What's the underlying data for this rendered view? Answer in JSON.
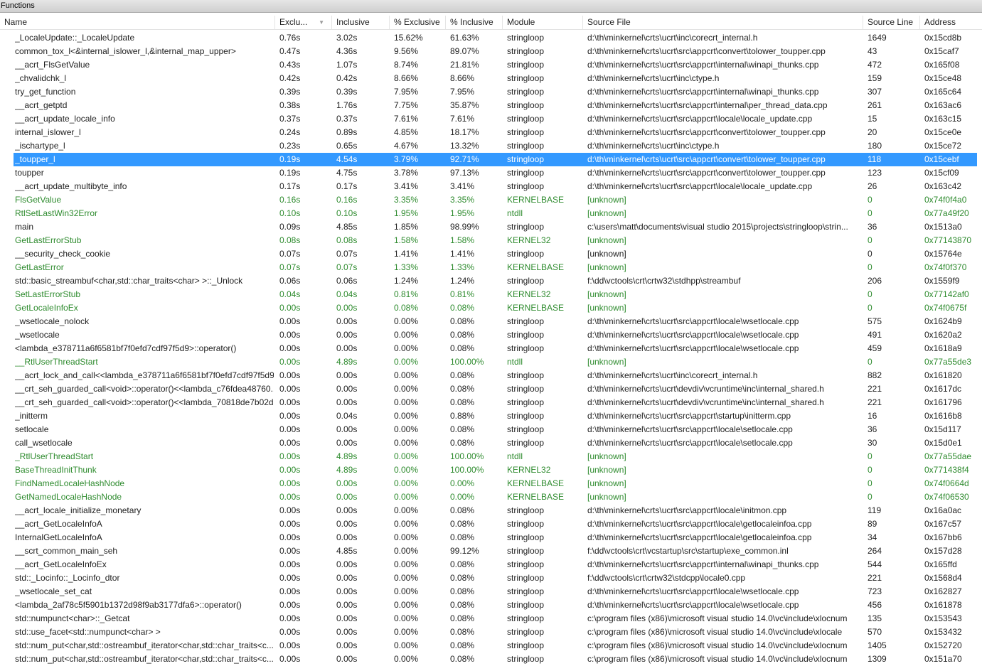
{
  "window": {
    "title": "Functions"
  },
  "columns": {
    "name": "Name",
    "exclusive": "Exclu...",
    "inclusive": "Inclusive",
    "pct_exclusive": "% Exclusive",
    "pct_inclusive": "% Inclusive",
    "module": "Module",
    "source_file": "Source File",
    "source_line": "Source Line",
    "address": "Address"
  },
  "colors": {
    "selected": "#3399ff",
    "external": "#2e8b2e"
  },
  "selected_index": 9,
  "rows": [
    {
      "name": "_LocaleUpdate::_LocaleUpdate",
      "excl": "0.76s",
      "incl": "3.02s",
      "pexcl": "15.62%",
      "pincl": "61.63%",
      "module": "stringloop",
      "file": "d:\\th\\minkernel\\crts\\ucrt\\inc\\corecrt_internal.h",
      "line": "1649",
      "addr": "0x15cd8b",
      "ext": false
    },
    {
      "name": "common_tox_l<&internal_islower_l,&internal_map_upper>",
      "excl": "0.47s",
      "incl": "4.36s",
      "pexcl": "9.56%",
      "pincl": "89.07%",
      "module": "stringloop",
      "file": "d:\\th\\minkernel\\crts\\ucrt\\src\\appcrt\\convert\\tolower_toupper.cpp",
      "line": "43",
      "addr": "0x15caf7",
      "ext": false
    },
    {
      "name": "__acrt_FlsGetValue",
      "excl": "0.43s",
      "incl": "1.07s",
      "pexcl": "8.74%",
      "pincl": "21.81%",
      "module": "stringloop",
      "file": "d:\\th\\minkernel\\crts\\ucrt\\src\\appcrt\\internal\\winapi_thunks.cpp",
      "line": "472",
      "addr": "0x165f08",
      "ext": false
    },
    {
      "name": "_chvalidchk_l",
      "excl": "0.42s",
      "incl": "0.42s",
      "pexcl": "8.66%",
      "pincl": "8.66%",
      "module": "stringloop",
      "file": "d:\\th\\minkernel\\crts\\ucrt\\inc\\ctype.h",
      "line": "159",
      "addr": "0x15ce48",
      "ext": false
    },
    {
      "name": "try_get_function",
      "excl": "0.39s",
      "incl": "0.39s",
      "pexcl": "7.95%",
      "pincl": "7.95%",
      "module": "stringloop",
      "file": "d:\\th\\minkernel\\crts\\ucrt\\src\\appcrt\\internal\\winapi_thunks.cpp",
      "line": "307",
      "addr": "0x165c64",
      "ext": false
    },
    {
      "name": "__acrt_getptd",
      "excl": "0.38s",
      "incl": "1.76s",
      "pexcl": "7.75%",
      "pincl": "35.87%",
      "module": "stringloop",
      "file": "d:\\th\\minkernel\\crts\\ucrt\\src\\appcrt\\internal\\per_thread_data.cpp",
      "line": "261",
      "addr": "0x163ac6",
      "ext": false
    },
    {
      "name": "__acrt_update_locale_info",
      "excl": "0.37s",
      "incl": "0.37s",
      "pexcl": "7.61%",
      "pincl": "7.61%",
      "module": "stringloop",
      "file": "d:\\th\\minkernel\\crts\\ucrt\\src\\appcrt\\locale\\locale_update.cpp",
      "line": "15",
      "addr": "0x163c15",
      "ext": false
    },
    {
      "name": "internal_islower_l",
      "excl": "0.24s",
      "incl": "0.89s",
      "pexcl": "4.85%",
      "pincl": "18.17%",
      "module": "stringloop",
      "file": "d:\\th\\minkernel\\crts\\ucrt\\src\\appcrt\\convert\\tolower_toupper.cpp",
      "line": "20",
      "addr": "0x15ce0e",
      "ext": false
    },
    {
      "name": "_ischartype_l",
      "excl": "0.23s",
      "incl": "0.65s",
      "pexcl": "4.67%",
      "pincl": "13.32%",
      "module": "stringloop",
      "file": "d:\\th\\minkernel\\crts\\ucrt\\inc\\ctype.h",
      "line": "180",
      "addr": "0x15ce72",
      "ext": false
    },
    {
      "name": "_toupper_l",
      "excl": "0.19s",
      "incl": "4.54s",
      "pexcl": "3.79%",
      "pincl": "92.71%",
      "module": "stringloop",
      "file": "d:\\th\\minkernel\\crts\\ucrt\\src\\appcrt\\convert\\tolower_toupper.cpp",
      "line": "118",
      "addr": "0x15cebf",
      "ext": false
    },
    {
      "name": "toupper",
      "excl": "0.19s",
      "incl": "4.75s",
      "pexcl": "3.78%",
      "pincl": "97.13%",
      "module": "stringloop",
      "file": "d:\\th\\minkernel\\crts\\ucrt\\src\\appcrt\\convert\\tolower_toupper.cpp",
      "line": "123",
      "addr": "0x15cf09",
      "ext": false
    },
    {
      "name": "__acrt_update_multibyte_info",
      "excl": "0.17s",
      "incl": "0.17s",
      "pexcl": "3.41%",
      "pincl": "3.41%",
      "module": "stringloop",
      "file": "d:\\th\\minkernel\\crts\\ucrt\\src\\appcrt\\locale\\locale_update.cpp",
      "line": "26",
      "addr": "0x163c42",
      "ext": false
    },
    {
      "name": "FlsGetValue",
      "excl": "0.16s",
      "incl": "0.16s",
      "pexcl": "3.35%",
      "pincl": "3.35%",
      "module": "KERNELBASE",
      "file": "[unknown]",
      "line": "0",
      "addr": "0x74f0f4a0",
      "ext": true
    },
    {
      "name": "RtlSetLastWin32Error",
      "excl": "0.10s",
      "incl": "0.10s",
      "pexcl": "1.95%",
      "pincl": "1.95%",
      "module": "ntdll",
      "file": "[unknown]",
      "line": "0",
      "addr": "0x77a49f20",
      "ext": true
    },
    {
      "name": "main",
      "excl": "0.09s",
      "incl": "4.85s",
      "pexcl": "1.85%",
      "pincl": "98.99%",
      "module": "stringloop",
      "file": "c:\\users\\matt\\documents\\visual studio 2015\\projects\\stringloop\\strin...",
      "line": "36",
      "addr": "0x1513a0",
      "ext": false
    },
    {
      "name": "GetLastErrorStub",
      "excl": "0.08s",
      "incl": "0.08s",
      "pexcl": "1.58%",
      "pincl": "1.58%",
      "module": "KERNEL32",
      "file": "[unknown]",
      "line": "0",
      "addr": "0x77143870",
      "ext": true
    },
    {
      "name": "__security_check_cookie",
      "excl": "0.07s",
      "incl": "0.07s",
      "pexcl": "1.41%",
      "pincl": "1.41%",
      "module": "stringloop",
      "file": "[unknown]",
      "line": "0",
      "addr": "0x15764e",
      "ext": false
    },
    {
      "name": "GetLastError",
      "excl": "0.07s",
      "incl": "0.07s",
      "pexcl": "1.33%",
      "pincl": "1.33%",
      "module": "KERNELBASE",
      "file": "[unknown]",
      "line": "0",
      "addr": "0x74f0f370",
      "ext": true
    },
    {
      "name": "std::basic_streambuf<char,std::char_traits<char> >::_Unlock",
      "excl": "0.06s",
      "incl": "0.06s",
      "pexcl": "1.24%",
      "pincl": "1.24%",
      "module": "stringloop",
      "file": "f:\\dd\\vctools\\crt\\crtw32\\stdhpp\\streambuf",
      "line": "206",
      "addr": "0x1559f9",
      "ext": false
    },
    {
      "name": "SetLastErrorStub",
      "excl": "0.04s",
      "incl": "0.04s",
      "pexcl": "0.81%",
      "pincl": "0.81%",
      "module": "KERNEL32",
      "file": "[unknown]",
      "line": "0",
      "addr": "0x77142af0",
      "ext": true
    },
    {
      "name": "GetLocaleInfoEx",
      "excl": "0.00s",
      "incl": "0.00s",
      "pexcl": "0.08%",
      "pincl": "0.08%",
      "module": "KERNELBASE",
      "file": "[unknown]",
      "line": "0",
      "addr": "0x74f0675f",
      "ext": true
    },
    {
      "name": "_wsetlocale_nolock",
      "excl": "0.00s",
      "incl": "0.00s",
      "pexcl": "0.00%",
      "pincl": "0.08%",
      "module": "stringloop",
      "file": "d:\\th\\minkernel\\crts\\ucrt\\src\\appcrt\\locale\\wsetlocale.cpp",
      "line": "575",
      "addr": "0x1624b9",
      "ext": false
    },
    {
      "name": "_wsetlocale",
      "excl": "0.00s",
      "incl": "0.00s",
      "pexcl": "0.00%",
      "pincl": "0.08%",
      "module": "stringloop",
      "file": "d:\\th\\minkernel\\crts\\ucrt\\src\\appcrt\\locale\\wsetlocale.cpp",
      "line": "491",
      "addr": "0x1620a2",
      "ext": false
    },
    {
      "name": "<lambda_e378711a6f6581bf7f0efd7cdf97f5d9>::operator()",
      "excl": "0.00s",
      "incl": "0.00s",
      "pexcl": "0.00%",
      "pincl": "0.08%",
      "module": "stringloop",
      "file": "d:\\th\\minkernel\\crts\\ucrt\\src\\appcrt\\locale\\wsetlocale.cpp",
      "line": "459",
      "addr": "0x1618a9",
      "ext": false
    },
    {
      "name": "__RtlUserThreadStart",
      "excl": "0.00s",
      "incl": "4.89s",
      "pexcl": "0.00%",
      "pincl": "100.00%",
      "module": "ntdll",
      "file": "[unknown]",
      "line": "0",
      "addr": "0x77a55de3",
      "ext": true
    },
    {
      "name": "__acrt_lock_and_call<<lambda_e378711a6f6581bf7f0efd7cdf97f5d9...",
      "excl": "0.00s",
      "incl": "0.00s",
      "pexcl": "0.00%",
      "pincl": "0.08%",
      "module": "stringloop",
      "file": "d:\\th\\minkernel\\crts\\ucrt\\inc\\corecrt_internal.h",
      "line": "882",
      "addr": "0x161820",
      "ext": false
    },
    {
      "name": "__crt_seh_guarded_call<void>::operator()<<lambda_c76fdea48760...",
      "excl": "0.00s",
      "incl": "0.00s",
      "pexcl": "0.00%",
      "pincl": "0.08%",
      "module": "stringloop",
      "file": "d:\\th\\minkernel\\crts\\ucrt\\devdiv\\vcruntime\\inc\\internal_shared.h",
      "line": "221",
      "addr": "0x1617dc",
      "ext": false
    },
    {
      "name": "__crt_seh_guarded_call<void>::operator()<<lambda_70818de7b02d...",
      "excl": "0.00s",
      "incl": "0.00s",
      "pexcl": "0.00%",
      "pincl": "0.08%",
      "module": "stringloop",
      "file": "d:\\th\\minkernel\\crts\\ucrt\\devdiv\\vcruntime\\inc\\internal_shared.h",
      "line": "221",
      "addr": "0x161796",
      "ext": false
    },
    {
      "name": "_initterm",
      "excl": "0.00s",
      "incl": "0.04s",
      "pexcl": "0.00%",
      "pincl": "0.88%",
      "module": "stringloop",
      "file": "d:\\th\\minkernel\\crts\\ucrt\\src\\appcrt\\startup\\initterm.cpp",
      "line": "16",
      "addr": "0x1616b8",
      "ext": false
    },
    {
      "name": "setlocale",
      "excl": "0.00s",
      "incl": "0.00s",
      "pexcl": "0.00%",
      "pincl": "0.08%",
      "module": "stringloop",
      "file": "d:\\th\\minkernel\\crts\\ucrt\\src\\appcrt\\locale\\setlocale.cpp",
      "line": "36",
      "addr": "0x15d117",
      "ext": false
    },
    {
      "name": "call_wsetlocale",
      "excl": "0.00s",
      "incl": "0.00s",
      "pexcl": "0.00%",
      "pincl": "0.08%",
      "module": "stringloop",
      "file": "d:\\th\\minkernel\\crts\\ucrt\\src\\appcrt\\locale\\setlocale.cpp",
      "line": "30",
      "addr": "0x15d0e1",
      "ext": false
    },
    {
      "name": "_RtlUserThreadStart",
      "excl": "0.00s",
      "incl": "4.89s",
      "pexcl": "0.00%",
      "pincl": "100.00%",
      "module": "ntdll",
      "file": "[unknown]",
      "line": "0",
      "addr": "0x77a55dae",
      "ext": true
    },
    {
      "name": "BaseThreadInitThunk",
      "excl": "0.00s",
      "incl": "4.89s",
      "pexcl": "0.00%",
      "pincl": "100.00%",
      "module": "KERNEL32",
      "file": "[unknown]",
      "line": "0",
      "addr": "0x771438f4",
      "ext": true
    },
    {
      "name": "FindNamedLocaleHashNode",
      "excl": "0.00s",
      "incl": "0.00s",
      "pexcl": "0.00%",
      "pincl": "0.00%",
      "module": "KERNELBASE",
      "file": "[unknown]",
      "line": "0",
      "addr": "0x74f0664d",
      "ext": true
    },
    {
      "name": "GetNamedLocaleHashNode",
      "excl": "0.00s",
      "incl": "0.00s",
      "pexcl": "0.00%",
      "pincl": "0.00%",
      "module": "KERNELBASE",
      "file": "[unknown]",
      "line": "0",
      "addr": "0x74f06530",
      "ext": true
    },
    {
      "name": "__acrt_locale_initialize_monetary",
      "excl": "0.00s",
      "incl": "0.00s",
      "pexcl": "0.00%",
      "pincl": "0.08%",
      "module": "stringloop",
      "file": "d:\\th\\minkernel\\crts\\ucrt\\src\\appcrt\\locale\\initmon.cpp",
      "line": "119",
      "addr": "0x16a0ac",
      "ext": false
    },
    {
      "name": "__acrt_GetLocaleInfoA",
      "excl": "0.00s",
      "incl": "0.00s",
      "pexcl": "0.00%",
      "pincl": "0.08%",
      "module": "stringloop",
      "file": "d:\\th\\minkernel\\crts\\ucrt\\src\\appcrt\\locale\\getlocaleinfoa.cpp",
      "line": "89",
      "addr": "0x167c57",
      "ext": false
    },
    {
      "name": "InternalGetLocaleInfoA",
      "excl": "0.00s",
      "incl": "0.00s",
      "pexcl": "0.00%",
      "pincl": "0.08%",
      "module": "stringloop",
      "file": "d:\\th\\minkernel\\crts\\ucrt\\src\\appcrt\\locale\\getlocaleinfoa.cpp",
      "line": "34",
      "addr": "0x167bb6",
      "ext": false
    },
    {
      "name": "__scrt_common_main_seh",
      "excl": "0.00s",
      "incl": "4.85s",
      "pexcl": "0.00%",
      "pincl": "99.12%",
      "module": "stringloop",
      "file": "f:\\dd\\vctools\\crt\\vcstartup\\src\\startup\\exe_common.inl",
      "line": "264",
      "addr": "0x157d28",
      "ext": false
    },
    {
      "name": "__acrt_GetLocaleInfoEx",
      "excl": "0.00s",
      "incl": "0.00s",
      "pexcl": "0.00%",
      "pincl": "0.08%",
      "module": "stringloop",
      "file": "d:\\th\\minkernel\\crts\\ucrt\\src\\appcrt\\internal\\winapi_thunks.cpp",
      "line": "544",
      "addr": "0x165ffd",
      "ext": false
    },
    {
      "name": "std::_Locinfo::_Locinfo_dtor",
      "excl": "0.00s",
      "incl": "0.00s",
      "pexcl": "0.00%",
      "pincl": "0.08%",
      "module": "stringloop",
      "file": "f:\\dd\\vctools\\crt\\crtw32\\stdcpp\\locale0.cpp",
      "line": "221",
      "addr": "0x1568d4",
      "ext": false
    },
    {
      "name": "_wsetlocale_set_cat",
      "excl": "0.00s",
      "incl": "0.00s",
      "pexcl": "0.00%",
      "pincl": "0.08%",
      "module": "stringloop",
      "file": "d:\\th\\minkernel\\crts\\ucrt\\src\\appcrt\\locale\\wsetlocale.cpp",
      "line": "723",
      "addr": "0x162827",
      "ext": false
    },
    {
      "name": "<lambda_2af78c5f5901b1372d98f9ab3177dfa6>::operator()",
      "excl": "0.00s",
      "incl": "0.00s",
      "pexcl": "0.00%",
      "pincl": "0.08%",
      "module": "stringloop",
      "file": "d:\\th\\minkernel\\crts\\ucrt\\src\\appcrt\\locale\\wsetlocale.cpp",
      "line": "456",
      "addr": "0x161878",
      "ext": false
    },
    {
      "name": "std::numpunct<char>::_Getcat",
      "excl": "0.00s",
      "incl": "0.00s",
      "pexcl": "0.00%",
      "pincl": "0.08%",
      "module": "stringloop",
      "file": "c:\\program files (x86)\\microsoft visual studio 14.0\\vc\\include\\xlocnum",
      "line": "135",
      "addr": "0x153543",
      "ext": false
    },
    {
      "name": "std::use_facet<std::numpunct<char> >",
      "excl": "0.00s",
      "incl": "0.00s",
      "pexcl": "0.00%",
      "pincl": "0.08%",
      "module": "stringloop",
      "file": "c:\\program files (x86)\\microsoft visual studio 14.0\\vc\\include\\xlocale",
      "line": "570",
      "addr": "0x153432",
      "ext": false
    },
    {
      "name": "std::num_put<char,std::ostreambuf_iterator<char,std::char_traits<c...",
      "excl": "0.00s",
      "incl": "0.00s",
      "pexcl": "0.00%",
      "pincl": "0.08%",
      "module": "stringloop",
      "file": "c:\\program files (x86)\\microsoft visual studio 14.0\\vc\\include\\xlocnum",
      "line": "1405",
      "addr": "0x152720",
      "ext": false
    },
    {
      "name": "std::num_put<char,std::ostreambuf_iterator<char,std::char_traits<c...",
      "excl": "0.00s",
      "incl": "0.00s",
      "pexcl": "0.00%",
      "pincl": "0.08%",
      "module": "stringloop",
      "file": "c:\\program files (x86)\\microsoft visual studio 14.0\\vc\\include\\xlocnum",
      "line": "1309",
      "addr": "0x151a70",
      "ext": false
    }
  ]
}
